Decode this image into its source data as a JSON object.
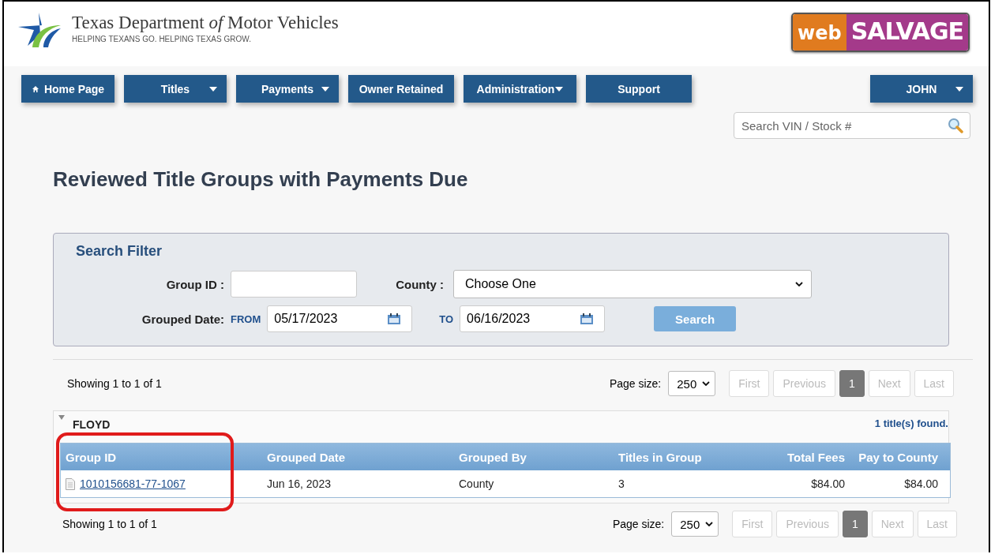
{
  "header": {
    "agency_name": "Texas Department *of* Motor Vehicles",
    "tagline": "HELPING TEXANS GO. HELPING TEXAS GROW.",
    "app_logo": {
      "left": "web",
      "right": "SALVAGE"
    }
  },
  "nav": [
    {
      "label": "Home Page",
      "kind": "home"
    },
    {
      "label": "Titles",
      "kind": "dropdown"
    },
    {
      "label": "Payments",
      "kind": "dropdown"
    },
    {
      "label": "Owner Retained",
      "kind": "plain"
    },
    {
      "label": "Administration",
      "kind": "compact-dropdown"
    },
    {
      "label": "Support",
      "kind": "plain"
    }
  ],
  "user_menu": {
    "label": "JOHN"
  },
  "vin_search": {
    "placeholder": "Search VIN / Stock #"
  },
  "page_title": "Reviewed Title Groups with Payments Due",
  "search_filter": {
    "title": "Search Filter",
    "group_id_label": "Group ID :",
    "county_label": "County :",
    "county_value": "Choose One",
    "date_label": "Grouped Date:",
    "from_label": "FROM",
    "from_value": "05/17/2023",
    "to_label": "TO",
    "to_value": "06/16/2023",
    "search_button": "Search"
  },
  "top_pager": {
    "summary": "Showing 1 to 1 of 1",
    "page_size_label": "Page size:",
    "page_size": "250",
    "pages": [
      {
        "label": "First",
        "selected": false,
        "disabled": true
      },
      {
        "label": "Previous",
        "selected": false,
        "disabled": true
      },
      {
        "label": "1",
        "selected": true,
        "disabled": false
      },
      {
        "label": "Next",
        "selected": false,
        "disabled": true
      },
      {
        "label": "Last",
        "selected": false,
        "disabled": true
      }
    ]
  },
  "group": {
    "name": "FLOYD",
    "expanded": true,
    "found": "1 title(s) found.",
    "columns": [
      {
        "label": "Group ID",
        "highlighted": true
      },
      {
        "label": "Grouped Date",
        "highlighted": false
      },
      {
        "label": "Grouped By",
        "highlighted": false
      },
      {
        "label": "Titles in Group",
        "highlighted": false
      },
      {
        "label": "Total Fees",
        "highlighted": false
      },
      {
        "label": "Pay to County",
        "highlighted": false
      }
    ],
    "rows": [
      [
        "1010156681-77-1067",
        "Jun 16, 2023",
        "County",
        "3",
        "$84.00",
        "$84.00"
      ]
    ]
  },
  "bottom_pager": {
    "summary": "Showing 1 to 1 of 1",
    "page_size_label": "Page size:",
    "page_size": "250",
    "pages": [
      {
        "label": "First",
        "selected": false,
        "disabled": true
      },
      {
        "label": "Previous",
        "selected": false,
        "disabled": true
      },
      {
        "label": "1",
        "selected": true,
        "disabled": false
      },
      {
        "label": "Next",
        "selected": false,
        "disabled": true
      },
      {
        "label": "Last",
        "selected": false,
        "disabled": true
      }
    ]
  }
}
